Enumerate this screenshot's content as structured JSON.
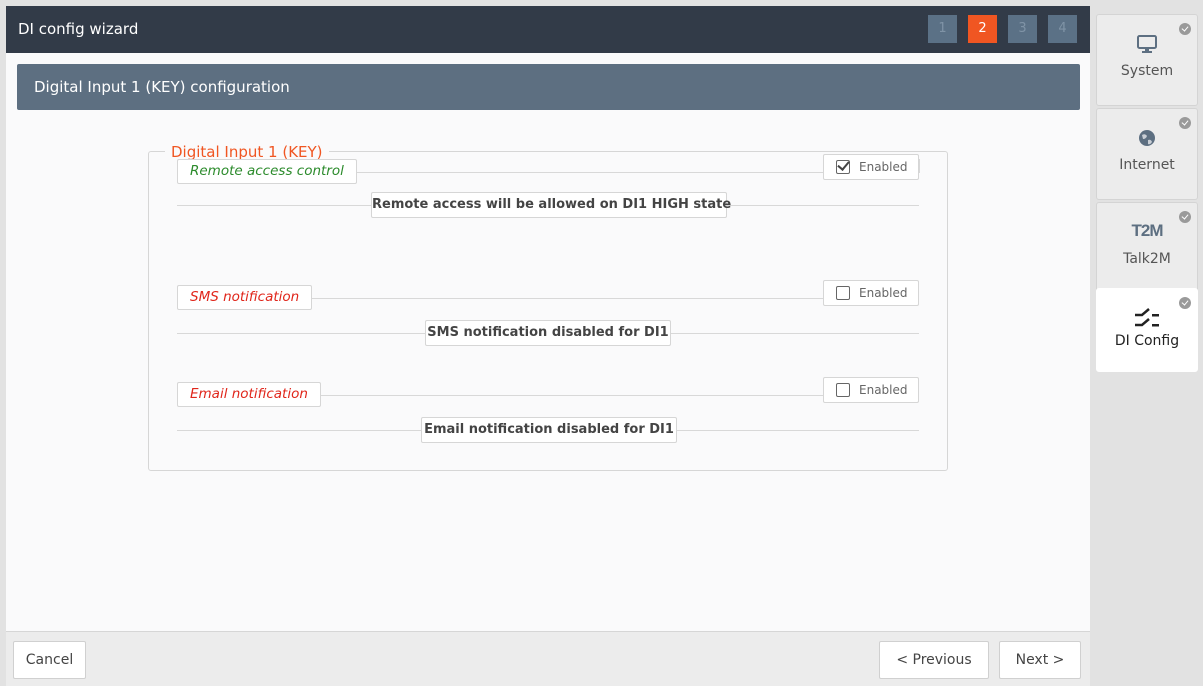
{
  "window": {
    "title": "DI config wizard"
  },
  "steps": [
    {
      "label": "1",
      "active": false
    },
    {
      "label": "2",
      "active": true
    },
    {
      "label": "3",
      "active": false
    },
    {
      "label": "4",
      "active": false
    }
  ],
  "section": {
    "title": "Digital Input 1 (KEY) configuration"
  },
  "fieldset": {
    "legend": "Digital Input 1 (KEY)",
    "rows": [
      {
        "label": "Remote access control",
        "enabled_label": "Enabled",
        "enabled": true,
        "description": "Remote access will be allowed on DI1 HIGH state"
      },
      {
        "label": "SMS notification",
        "enabled_label": "Enabled",
        "enabled": false,
        "description": "SMS notification disabled for DI1"
      },
      {
        "label": "Email notification",
        "enabled_label": "Enabled",
        "enabled": false,
        "description": "Email notification disabled for DI1"
      }
    ]
  },
  "footer": {
    "cancel": "Cancel",
    "previous": "< Previous",
    "next": "Next >"
  },
  "sidebar": {
    "items": [
      {
        "label": "System",
        "icon": "monitor-icon",
        "active": false
      },
      {
        "label": "Internet",
        "icon": "globe-icon",
        "active": false
      },
      {
        "label": "Talk2M",
        "icon": "t2m-logo-icon",
        "logo_text": "T2M",
        "active": false
      },
      {
        "label": "DI Config",
        "icon": "switch-icon",
        "active": true
      }
    ]
  },
  "colors": {
    "titlebar": "#323b48",
    "accent": "#f05622",
    "section_header": "#5d6f81",
    "green_label": "#2c8b2c",
    "red_label": "#e0261b"
  }
}
